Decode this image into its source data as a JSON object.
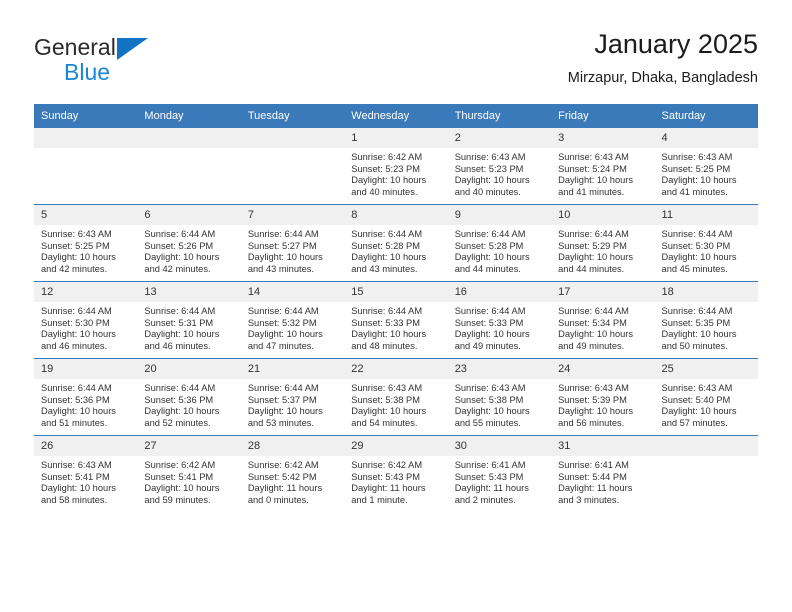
{
  "brand": {
    "name_top": "General",
    "name_bottom": "Blue",
    "triangle_icon": "brand-triangle-icon",
    "colors": {
      "blue": "#1a86d8",
      "triangle": "#1272c4",
      "dark": "#2b2b2b"
    }
  },
  "header": {
    "title": "January 2025",
    "subtitle": "Mirzapur, Dhaka, Bangladesh"
  },
  "theme": {
    "header_blue": "#3a79ba",
    "daynum_band": "#f0f0f0",
    "text": "#333333"
  },
  "calendar": {
    "weekdays": [
      "Sunday",
      "Monday",
      "Tuesday",
      "Wednesday",
      "Thursday",
      "Friday",
      "Saturday"
    ],
    "weeks": [
      [
        {
          "day": "",
          "sunrise": "",
          "sunset": "",
          "daylight_1": "",
          "daylight_2": ""
        },
        {
          "day": "",
          "sunrise": "",
          "sunset": "",
          "daylight_1": "",
          "daylight_2": ""
        },
        {
          "day": "",
          "sunrise": "",
          "sunset": "",
          "daylight_1": "",
          "daylight_2": ""
        },
        {
          "day": "1",
          "sunrise": "Sunrise: 6:42 AM",
          "sunset": "Sunset: 5:23 PM",
          "daylight_1": "Daylight: 10 hours",
          "daylight_2": "and 40 minutes."
        },
        {
          "day": "2",
          "sunrise": "Sunrise: 6:43 AM",
          "sunset": "Sunset: 5:23 PM",
          "daylight_1": "Daylight: 10 hours",
          "daylight_2": "and 40 minutes."
        },
        {
          "day": "3",
          "sunrise": "Sunrise: 6:43 AM",
          "sunset": "Sunset: 5:24 PM",
          "daylight_1": "Daylight: 10 hours",
          "daylight_2": "and 41 minutes."
        },
        {
          "day": "4",
          "sunrise": "Sunrise: 6:43 AM",
          "sunset": "Sunset: 5:25 PM",
          "daylight_1": "Daylight: 10 hours",
          "daylight_2": "and 41 minutes."
        }
      ],
      [
        {
          "day": "5",
          "sunrise": "Sunrise: 6:43 AM",
          "sunset": "Sunset: 5:25 PM",
          "daylight_1": "Daylight: 10 hours",
          "daylight_2": "and 42 minutes."
        },
        {
          "day": "6",
          "sunrise": "Sunrise: 6:44 AM",
          "sunset": "Sunset: 5:26 PM",
          "daylight_1": "Daylight: 10 hours",
          "daylight_2": "and 42 minutes."
        },
        {
          "day": "7",
          "sunrise": "Sunrise: 6:44 AM",
          "sunset": "Sunset: 5:27 PM",
          "daylight_1": "Daylight: 10 hours",
          "daylight_2": "and 43 minutes."
        },
        {
          "day": "8",
          "sunrise": "Sunrise: 6:44 AM",
          "sunset": "Sunset: 5:28 PM",
          "daylight_1": "Daylight: 10 hours",
          "daylight_2": "and 43 minutes."
        },
        {
          "day": "9",
          "sunrise": "Sunrise: 6:44 AM",
          "sunset": "Sunset: 5:28 PM",
          "daylight_1": "Daylight: 10 hours",
          "daylight_2": "and 44 minutes."
        },
        {
          "day": "10",
          "sunrise": "Sunrise: 6:44 AM",
          "sunset": "Sunset: 5:29 PM",
          "daylight_1": "Daylight: 10 hours",
          "daylight_2": "and 44 minutes."
        },
        {
          "day": "11",
          "sunrise": "Sunrise: 6:44 AM",
          "sunset": "Sunset: 5:30 PM",
          "daylight_1": "Daylight: 10 hours",
          "daylight_2": "and 45 minutes."
        }
      ],
      [
        {
          "day": "12",
          "sunrise": "Sunrise: 6:44 AM",
          "sunset": "Sunset: 5:30 PM",
          "daylight_1": "Daylight: 10 hours",
          "daylight_2": "and 46 minutes."
        },
        {
          "day": "13",
          "sunrise": "Sunrise: 6:44 AM",
          "sunset": "Sunset: 5:31 PM",
          "daylight_1": "Daylight: 10 hours",
          "daylight_2": "and 46 minutes."
        },
        {
          "day": "14",
          "sunrise": "Sunrise: 6:44 AM",
          "sunset": "Sunset: 5:32 PM",
          "daylight_1": "Daylight: 10 hours",
          "daylight_2": "and 47 minutes."
        },
        {
          "day": "15",
          "sunrise": "Sunrise: 6:44 AM",
          "sunset": "Sunset: 5:33 PM",
          "daylight_1": "Daylight: 10 hours",
          "daylight_2": "and 48 minutes."
        },
        {
          "day": "16",
          "sunrise": "Sunrise: 6:44 AM",
          "sunset": "Sunset: 5:33 PM",
          "daylight_1": "Daylight: 10 hours",
          "daylight_2": "and 49 minutes."
        },
        {
          "day": "17",
          "sunrise": "Sunrise: 6:44 AM",
          "sunset": "Sunset: 5:34 PM",
          "daylight_1": "Daylight: 10 hours",
          "daylight_2": "and 49 minutes."
        },
        {
          "day": "18",
          "sunrise": "Sunrise: 6:44 AM",
          "sunset": "Sunset: 5:35 PM",
          "daylight_1": "Daylight: 10 hours",
          "daylight_2": "and 50 minutes."
        }
      ],
      [
        {
          "day": "19",
          "sunrise": "Sunrise: 6:44 AM",
          "sunset": "Sunset: 5:36 PM",
          "daylight_1": "Daylight: 10 hours",
          "daylight_2": "and 51 minutes."
        },
        {
          "day": "20",
          "sunrise": "Sunrise: 6:44 AM",
          "sunset": "Sunset: 5:36 PM",
          "daylight_1": "Daylight: 10 hours",
          "daylight_2": "and 52 minutes."
        },
        {
          "day": "21",
          "sunrise": "Sunrise: 6:44 AM",
          "sunset": "Sunset: 5:37 PM",
          "daylight_1": "Daylight: 10 hours",
          "daylight_2": "and 53 minutes."
        },
        {
          "day": "22",
          "sunrise": "Sunrise: 6:43 AM",
          "sunset": "Sunset: 5:38 PM",
          "daylight_1": "Daylight: 10 hours",
          "daylight_2": "and 54 minutes."
        },
        {
          "day": "23",
          "sunrise": "Sunrise: 6:43 AM",
          "sunset": "Sunset: 5:38 PM",
          "daylight_1": "Daylight: 10 hours",
          "daylight_2": "and 55 minutes."
        },
        {
          "day": "24",
          "sunrise": "Sunrise: 6:43 AM",
          "sunset": "Sunset: 5:39 PM",
          "daylight_1": "Daylight: 10 hours",
          "daylight_2": "and 56 minutes."
        },
        {
          "day": "25",
          "sunrise": "Sunrise: 6:43 AM",
          "sunset": "Sunset: 5:40 PM",
          "daylight_1": "Daylight: 10 hours",
          "daylight_2": "and 57 minutes."
        }
      ],
      [
        {
          "day": "26",
          "sunrise": "Sunrise: 6:43 AM",
          "sunset": "Sunset: 5:41 PM",
          "daylight_1": "Daylight: 10 hours",
          "daylight_2": "and 58 minutes."
        },
        {
          "day": "27",
          "sunrise": "Sunrise: 6:42 AM",
          "sunset": "Sunset: 5:41 PM",
          "daylight_1": "Daylight: 10 hours",
          "daylight_2": "and 59 minutes."
        },
        {
          "day": "28",
          "sunrise": "Sunrise: 6:42 AM",
          "sunset": "Sunset: 5:42 PM",
          "daylight_1": "Daylight: 11 hours",
          "daylight_2": "and 0 minutes."
        },
        {
          "day": "29",
          "sunrise": "Sunrise: 6:42 AM",
          "sunset": "Sunset: 5:43 PM",
          "daylight_1": "Daylight: 11 hours",
          "daylight_2": "and 1 minute."
        },
        {
          "day": "30",
          "sunrise": "Sunrise: 6:41 AM",
          "sunset": "Sunset: 5:43 PM",
          "daylight_1": "Daylight: 11 hours",
          "daylight_2": "and 2 minutes."
        },
        {
          "day": "31",
          "sunrise": "Sunrise: 6:41 AM",
          "sunset": "Sunset: 5:44 PM",
          "daylight_1": "Daylight: 11 hours",
          "daylight_2": "and 3 minutes."
        },
        {
          "day": "",
          "sunrise": "",
          "sunset": "",
          "daylight_1": "",
          "daylight_2": ""
        }
      ]
    ]
  }
}
